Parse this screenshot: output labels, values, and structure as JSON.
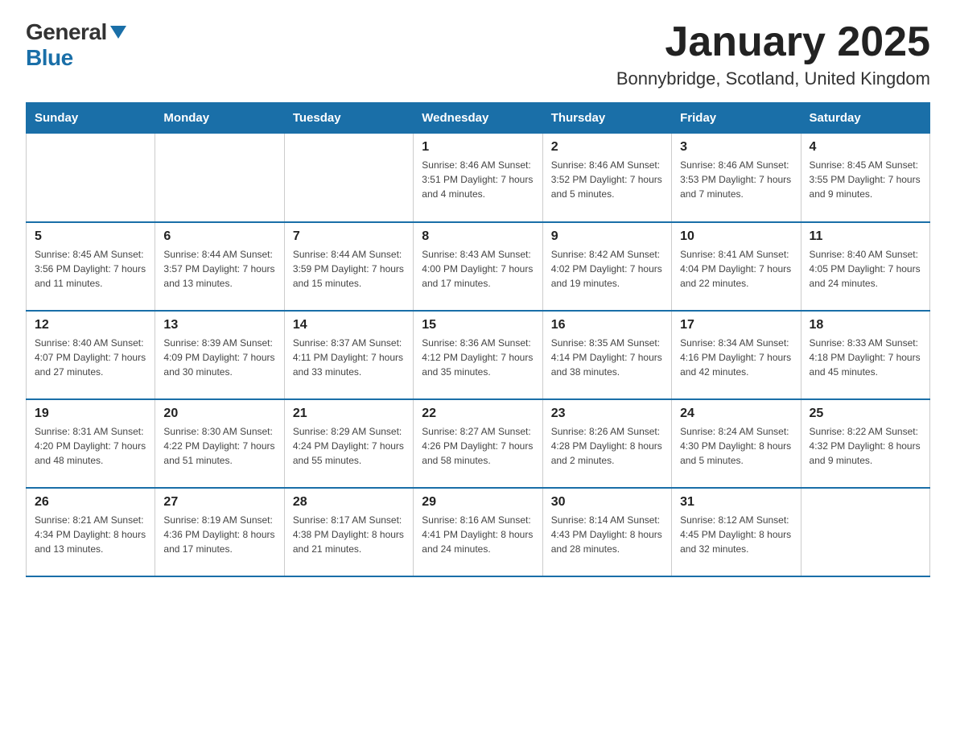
{
  "logo": {
    "general": "General",
    "blue": "Blue"
  },
  "title": "January 2025",
  "subtitle": "Bonnybridge, Scotland, United Kingdom",
  "days_of_week": [
    "Sunday",
    "Monday",
    "Tuesday",
    "Wednesday",
    "Thursday",
    "Friday",
    "Saturday"
  ],
  "weeks": [
    [
      {
        "day": "",
        "info": ""
      },
      {
        "day": "",
        "info": ""
      },
      {
        "day": "",
        "info": ""
      },
      {
        "day": "1",
        "info": "Sunrise: 8:46 AM\nSunset: 3:51 PM\nDaylight: 7 hours\nand 4 minutes."
      },
      {
        "day": "2",
        "info": "Sunrise: 8:46 AM\nSunset: 3:52 PM\nDaylight: 7 hours\nand 5 minutes."
      },
      {
        "day": "3",
        "info": "Sunrise: 8:46 AM\nSunset: 3:53 PM\nDaylight: 7 hours\nand 7 minutes."
      },
      {
        "day": "4",
        "info": "Sunrise: 8:45 AM\nSunset: 3:55 PM\nDaylight: 7 hours\nand 9 minutes."
      }
    ],
    [
      {
        "day": "5",
        "info": "Sunrise: 8:45 AM\nSunset: 3:56 PM\nDaylight: 7 hours\nand 11 minutes."
      },
      {
        "day": "6",
        "info": "Sunrise: 8:44 AM\nSunset: 3:57 PM\nDaylight: 7 hours\nand 13 minutes."
      },
      {
        "day": "7",
        "info": "Sunrise: 8:44 AM\nSunset: 3:59 PM\nDaylight: 7 hours\nand 15 minutes."
      },
      {
        "day": "8",
        "info": "Sunrise: 8:43 AM\nSunset: 4:00 PM\nDaylight: 7 hours\nand 17 minutes."
      },
      {
        "day": "9",
        "info": "Sunrise: 8:42 AM\nSunset: 4:02 PM\nDaylight: 7 hours\nand 19 minutes."
      },
      {
        "day": "10",
        "info": "Sunrise: 8:41 AM\nSunset: 4:04 PM\nDaylight: 7 hours\nand 22 minutes."
      },
      {
        "day": "11",
        "info": "Sunrise: 8:40 AM\nSunset: 4:05 PM\nDaylight: 7 hours\nand 24 minutes."
      }
    ],
    [
      {
        "day": "12",
        "info": "Sunrise: 8:40 AM\nSunset: 4:07 PM\nDaylight: 7 hours\nand 27 minutes."
      },
      {
        "day": "13",
        "info": "Sunrise: 8:39 AM\nSunset: 4:09 PM\nDaylight: 7 hours\nand 30 minutes."
      },
      {
        "day": "14",
        "info": "Sunrise: 8:37 AM\nSunset: 4:11 PM\nDaylight: 7 hours\nand 33 minutes."
      },
      {
        "day": "15",
        "info": "Sunrise: 8:36 AM\nSunset: 4:12 PM\nDaylight: 7 hours\nand 35 minutes."
      },
      {
        "day": "16",
        "info": "Sunrise: 8:35 AM\nSunset: 4:14 PM\nDaylight: 7 hours\nand 38 minutes."
      },
      {
        "day": "17",
        "info": "Sunrise: 8:34 AM\nSunset: 4:16 PM\nDaylight: 7 hours\nand 42 minutes."
      },
      {
        "day": "18",
        "info": "Sunrise: 8:33 AM\nSunset: 4:18 PM\nDaylight: 7 hours\nand 45 minutes."
      }
    ],
    [
      {
        "day": "19",
        "info": "Sunrise: 8:31 AM\nSunset: 4:20 PM\nDaylight: 7 hours\nand 48 minutes."
      },
      {
        "day": "20",
        "info": "Sunrise: 8:30 AM\nSunset: 4:22 PM\nDaylight: 7 hours\nand 51 minutes."
      },
      {
        "day": "21",
        "info": "Sunrise: 8:29 AM\nSunset: 4:24 PM\nDaylight: 7 hours\nand 55 minutes."
      },
      {
        "day": "22",
        "info": "Sunrise: 8:27 AM\nSunset: 4:26 PM\nDaylight: 7 hours\nand 58 minutes."
      },
      {
        "day": "23",
        "info": "Sunrise: 8:26 AM\nSunset: 4:28 PM\nDaylight: 8 hours\nand 2 minutes."
      },
      {
        "day": "24",
        "info": "Sunrise: 8:24 AM\nSunset: 4:30 PM\nDaylight: 8 hours\nand 5 minutes."
      },
      {
        "day": "25",
        "info": "Sunrise: 8:22 AM\nSunset: 4:32 PM\nDaylight: 8 hours\nand 9 minutes."
      }
    ],
    [
      {
        "day": "26",
        "info": "Sunrise: 8:21 AM\nSunset: 4:34 PM\nDaylight: 8 hours\nand 13 minutes."
      },
      {
        "day": "27",
        "info": "Sunrise: 8:19 AM\nSunset: 4:36 PM\nDaylight: 8 hours\nand 17 minutes."
      },
      {
        "day": "28",
        "info": "Sunrise: 8:17 AM\nSunset: 4:38 PM\nDaylight: 8 hours\nand 21 minutes."
      },
      {
        "day": "29",
        "info": "Sunrise: 8:16 AM\nSunset: 4:41 PM\nDaylight: 8 hours\nand 24 minutes."
      },
      {
        "day": "30",
        "info": "Sunrise: 8:14 AM\nSunset: 4:43 PM\nDaylight: 8 hours\nand 28 minutes."
      },
      {
        "day": "31",
        "info": "Sunrise: 8:12 AM\nSunset: 4:45 PM\nDaylight: 8 hours\nand 32 minutes."
      },
      {
        "day": "",
        "info": ""
      }
    ]
  ]
}
